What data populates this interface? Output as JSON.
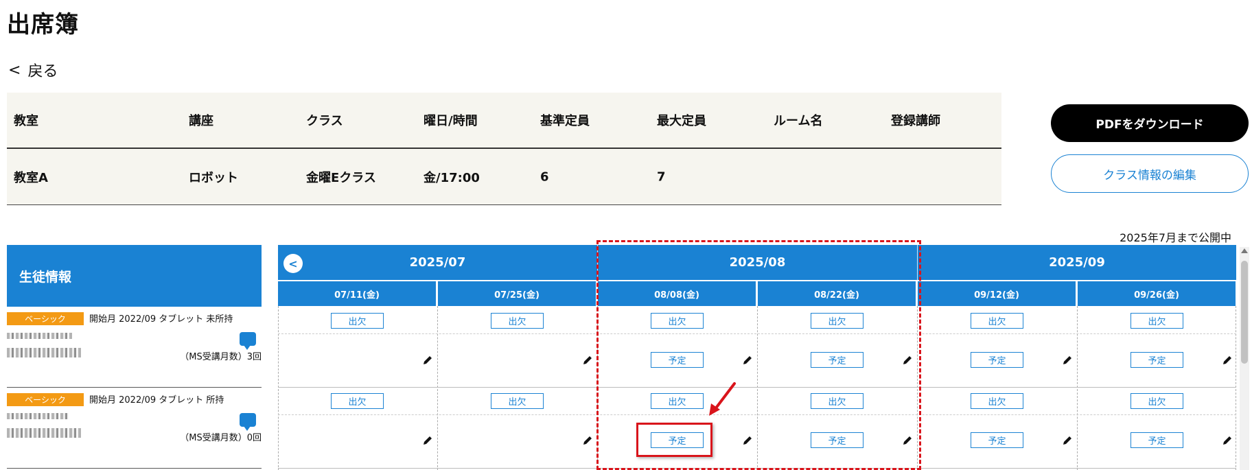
{
  "page": {
    "title": "出席簿",
    "back_label": "戻る",
    "back_symbol": "<"
  },
  "info_table": {
    "headers": [
      "教室",
      "講座",
      "クラス",
      "曜日/時間",
      "基準定員",
      "最大定員",
      "ルーム名",
      "登録講師"
    ],
    "values": [
      "教室A",
      "ロボット",
      "金曜Eクラス",
      "金/17:00",
      "6",
      "7",
      "",
      ""
    ]
  },
  "actions": {
    "pdf_label": "PDFをダウンロード",
    "edit_label": "クラス情報の編集"
  },
  "publish_note": "2025年7月まで公開中",
  "students_panel": {
    "header": "生徒情報",
    "students": [
      {
        "badge": "ベーシック",
        "meta": "開始月 2022/09  タブレット 未所持",
        "ms_count": "（MS受講月数）3回"
      },
      {
        "badge": "ベーシック",
        "meta": "開始月 2022/09  タブレット 所持",
        "ms_count": "（MS受講月数）0回"
      }
    ]
  },
  "calendar": {
    "prev_symbol": "<",
    "months": [
      "2025/07",
      "2025/08",
      "2025/09"
    ],
    "dates": [
      "07/11(金)",
      "07/25(金)",
      "08/08(金)",
      "08/22(金)",
      "09/12(金)",
      "09/26(金)"
    ],
    "attendance_label": "出欠",
    "plan_label": "予定"
  },
  "colors": {
    "accent": "#1a82d3",
    "badge": "#f39a14",
    "highlight": "#d9141b",
    "panel_bg": "#f6f5ef"
  },
  "icons": {
    "pencil": "pencil-icon",
    "chat": "chat-icon",
    "back": "chevron-left-icon"
  }
}
